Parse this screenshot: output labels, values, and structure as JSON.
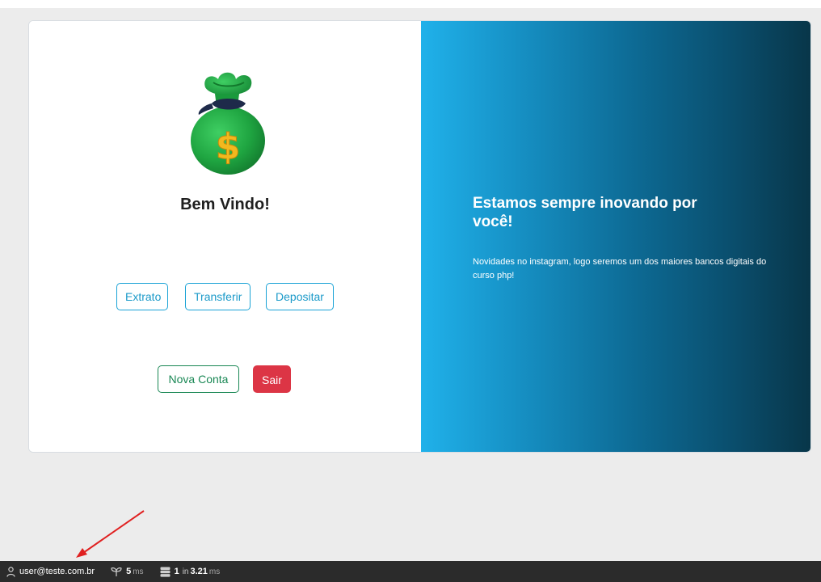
{
  "left_panel": {
    "title": "Bem Vindo!",
    "actions": [
      {
        "label": "Extrato"
      },
      {
        "label": "Transferir"
      },
      {
        "label": "Depositar"
      }
    ],
    "new_account_label": "Nova Conta",
    "logout_label": "Sair",
    "icon": "money-bag-icon"
  },
  "right_panel": {
    "title": "Estamos sempre inovando por você!",
    "text": "Novidades no instagram, logo seremos um dos maiores bancos digitais do curso php!"
  },
  "debug_bar": {
    "user": "user@teste.com.br",
    "time_value": "5",
    "time_unit": "ms",
    "db_count": "1",
    "db_in": "in",
    "db_time": "3.21",
    "db_unit": "ms"
  },
  "colors": {
    "info": "#1aa3d6",
    "success": "#198754",
    "danger": "#dc3545",
    "gradient_start": "#20b1ea",
    "gradient_end": "#083649",
    "annotation_arrow": "#e02020"
  }
}
